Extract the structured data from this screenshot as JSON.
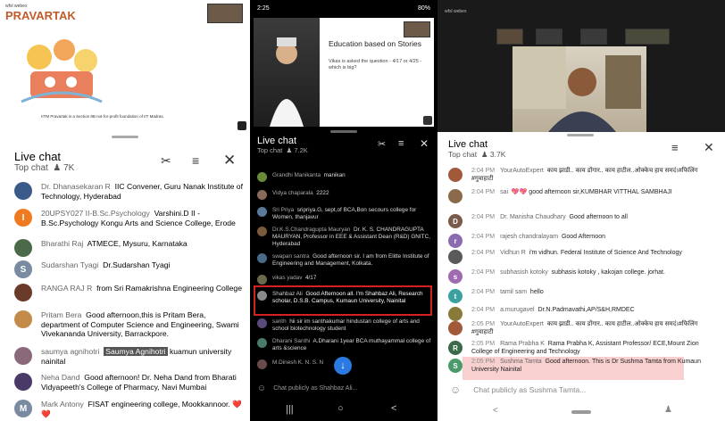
{
  "panel1": {
    "logo_small": "wfsl webex",
    "logo": "PRAVARTAK",
    "caption": "IITM Pravartak is a Section 8B not-for-profit foundation of IIT Madras.",
    "chat_title": "Live chat",
    "chat_sub": "Top chat",
    "viewers": "7K",
    "messages": [
      {
        "initial": "",
        "color": "#3a5a8a",
        "author": "Dr. Dhanasekaran R",
        "text": "IIC Convener, Guru Nanak Institute of Technology, Hyderabad"
      },
      {
        "initial": "I",
        "color": "#f07a20",
        "author": "20UPSY027 II-B.Sc.Psychology",
        "text": "Varshini.D II - B.Sc.Psychology Kongu Arts and Science College, Erode"
      },
      {
        "initial": "",
        "color": "#4a6a4a",
        "author": "Bharathi Raj",
        "text": "ATMECE, Mysuru, Karnataka"
      },
      {
        "initial": "S",
        "color": "#7a8aa0",
        "author": "Sudarshan Tyagi",
        "text": "Dr.Sudarshan Tyagi"
      },
      {
        "initial": "",
        "color": "#6a3a2a",
        "author": "RANGA RAJ R",
        "text": "from Sri Ramakrishna Engineering College"
      },
      {
        "initial": "",
        "color": "#c48a4a",
        "author": "Pritam Bera",
        "text": "Good afternoon,this is Pritam Bera, department of Computer Science and Engineering, Swami Vivekananda University, Barrackpore."
      },
      {
        "initial": "",
        "color": "#8a6a7a",
        "author": "saumya agnihotri",
        "highlight": "Saumya Agnihotri",
        "text": "kuamun university nainital"
      },
      {
        "initial": "",
        "color": "#4a3a6a",
        "author": "Neha Dand",
        "text": "Good afternoon! Dr. Neha Dand from Bharati Vidyapeeth's College of Pharmacy, Navi Mumbai"
      },
      {
        "initial": "M",
        "color": "#7a8aa0",
        "author": "Mark Antony",
        "text": "FISAT engineering college, Mookkannoor. ❤️❤️"
      }
    ]
  },
  "panel2": {
    "status_time": "2:25",
    "status_right": "80%",
    "slide_title": "Education based on Stories",
    "slide_text": "Vikas is asked the question - 4/17 or 4/25 - which is big?",
    "chat_title": "Live chat",
    "chat_sub": "Top chat",
    "viewers": "7.2K",
    "messages": [
      {
        "color": "#6a8a3a",
        "author": "Grandhi Manikanta",
        "text": "manikan"
      },
      {
        "color": "#8a6a5a",
        "author": "Vidya chaparala",
        "text": "2222"
      },
      {
        "color": "#5a7a9a",
        "author": "Sri Priya",
        "text": "sripriya.G, sept,of BCA,Bon secours college for Women, thanjavur"
      },
      {
        "color": "#7a5a3a",
        "author": "Dr.K.S.Chandragupta Mauryan",
        "text": "Dr. K. S. CHANDRAGUPTA MAURYAN, Professor in EEE & Assistant Dean (R&D) GNITC, Hyderabad"
      },
      {
        "color": "#4a6a8a",
        "author": "swapan santra",
        "text": "Good afternoon sir. I am from Elitte Institute of Engineering and Management, Kolkata."
      },
      {
        "color": "#6a6a4a",
        "author": "vikas yadav",
        "text": "4/17"
      },
      {
        "color": "#8a8a8a",
        "author": "Shahbaz Ali",
        "text": "Good Afternoon all. I'm Shahbaz Ali, Research scholar, D.S.B. Campus, Kumaun University, Nainital"
      },
      {
        "color": "#5a4a7a",
        "author": "santh",
        "text": "hii sir im santhakumar hindustan college of arts and school biotechnology student"
      },
      {
        "color": "#4a7a6a",
        "author": "Dharani Santhi",
        "text": "A.Dharani 1year BCA muthayammal college of arts &science"
      },
      {
        "color": "#6a4a4a",
        "author": "M.Dinesh K. N. S. N",
        "text": ""
      }
    ],
    "input_placeholder": "Chat publicly as Shahbaz Ali..."
  },
  "panel3": {
    "logo_small": "wfsl webex",
    "chat_title": "Live chat",
    "chat_sub": "Top chat",
    "viewers": "3.7K",
    "messages": [
      {
        "initial": "",
        "color": "#a05a3a",
        "time": "2:04 PM",
        "author": "YourAutoExpert",
        "text": "काय झाडी.. काय डोंगार.. काय हाटील..ओक्केच हाय समदं।#फिलिंग #गुवाहाटी"
      },
      {
        "initial": "",
        "color": "#8a6a4a",
        "time": "2:04 PM",
        "author": "sai",
        "text": "💖💖 good afternoon sir,KUMBHAR VITTHAL SAMBHAJI"
      },
      {
        "initial": "D",
        "color": "#7a5a4a",
        "time": "2:04 PM",
        "author": "Dr. Manisha Chaudhary",
        "text": "Good afternoon to all"
      },
      {
        "initial": "r",
        "color": "#8a6ab0",
        "time": "2:04 PM",
        "author": "rajesh chandralayam",
        "text": "Good Afternoon"
      },
      {
        "initial": "",
        "color": "#5a5a5a",
        "time": "2:04 PM",
        "author": "Vidhun R",
        "text": "i'm vidhun. Federal Institute of Science And Technology"
      },
      {
        "initial": "s",
        "color": "#a06ab0",
        "time": "2:04 PM",
        "author": "subhasish kotoky",
        "text": "subhasis kotoky , kakojan college. jorhat."
      },
      {
        "initial": "t",
        "color": "#3aa0a0",
        "time": "2:04 PM",
        "author": "tamil sam",
        "text": "hello"
      },
      {
        "initial": "",
        "color": "#8a7a3a",
        "time": "2:04 PM",
        "author": "a.murugavel",
        "text": "Dr.N.Padmavathi,AP/S&H,RMDEC"
      },
      {
        "initial": "",
        "color": "#a05a3a",
        "time": "2:05 PM",
        "author": "YourAutoExpert",
        "text": "काय झाडी.. काय डोंगार.. काय हाटील..ओक्केच हाय समदं।#फिलिंग #गुवाहाटी"
      },
      {
        "initial": "R",
        "color": "#3a6a4a",
        "time": "2:05 PM",
        "author": "Rama Prabha K",
        "text": "Rama Prabha K, Assistant Professor/ ECE,Mount Zion College of Engineering and Technology"
      },
      {
        "initial": "S",
        "color": "#4a9a6a",
        "time": "2:05 PM",
        "author": "Sushma Tamta",
        "text": "Good afternoon. This is Dr Sushma Tamta from Kumaun University Nainital"
      }
    ],
    "input_placeholder": "Chat publicly as Sushma Tamta..."
  }
}
